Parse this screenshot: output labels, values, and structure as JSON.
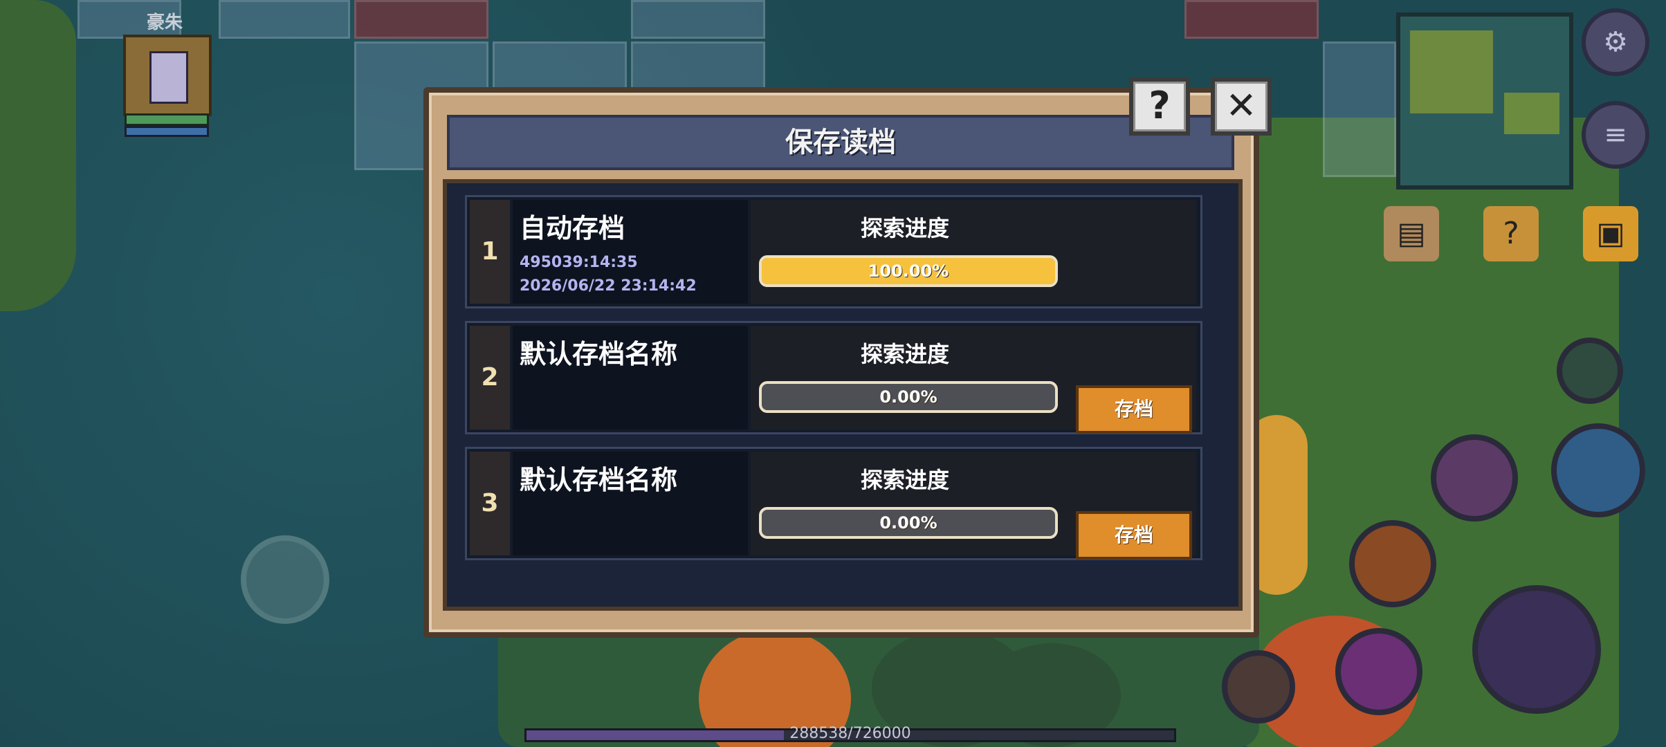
{
  "player": {
    "name": "豪朱"
  },
  "dialog": {
    "title": "保存读档",
    "help_label": "?",
    "close_label": "✕"
  },
  "slots": [
    {
      "number": "1",
      "name": "自动存档",
      "playtime": "495039:14:35",
      "date": "2026/06/22 23:14:42",
      "progress_label": "探索进度",
      "progress_text": "100.00%",
      "progress": 1.0,
      "save_label": ""
    },
    {
      "number": "2",
      "name": "默认存档名称",
      "playtime": "",
      "date": "",
      "progress_label": "探索进度",
      "progress_text": "0.00%",
      "progress": 0.0,
      "save_label": "存档"
    },
    {
      "number": "3",
      "name": "默认存档名称",
      "playtime": "",
      "date": "",
      "progress_label": "探索进度",
      "progress_text": "0.00%",
      "progress": 0.0,
      "save_label": "存档"
    }
  ],
  "experience": {
    "text": "288538/726000",
    "current": 288538,
    "max": 726000
  },
  "hud_icons": [
    "settings-icon",
    "log-icon",
    "map-scroll-icon",
    "quest-icon",
    "chest-icon",
    "skill-icon",
    "potion-icon"
  ],
  "colors": {
    "progress_fill": "#f6c23e",
    "save_button": "#e08d2c",
    "dialog_frame": "#c7a57f"
  }
}
